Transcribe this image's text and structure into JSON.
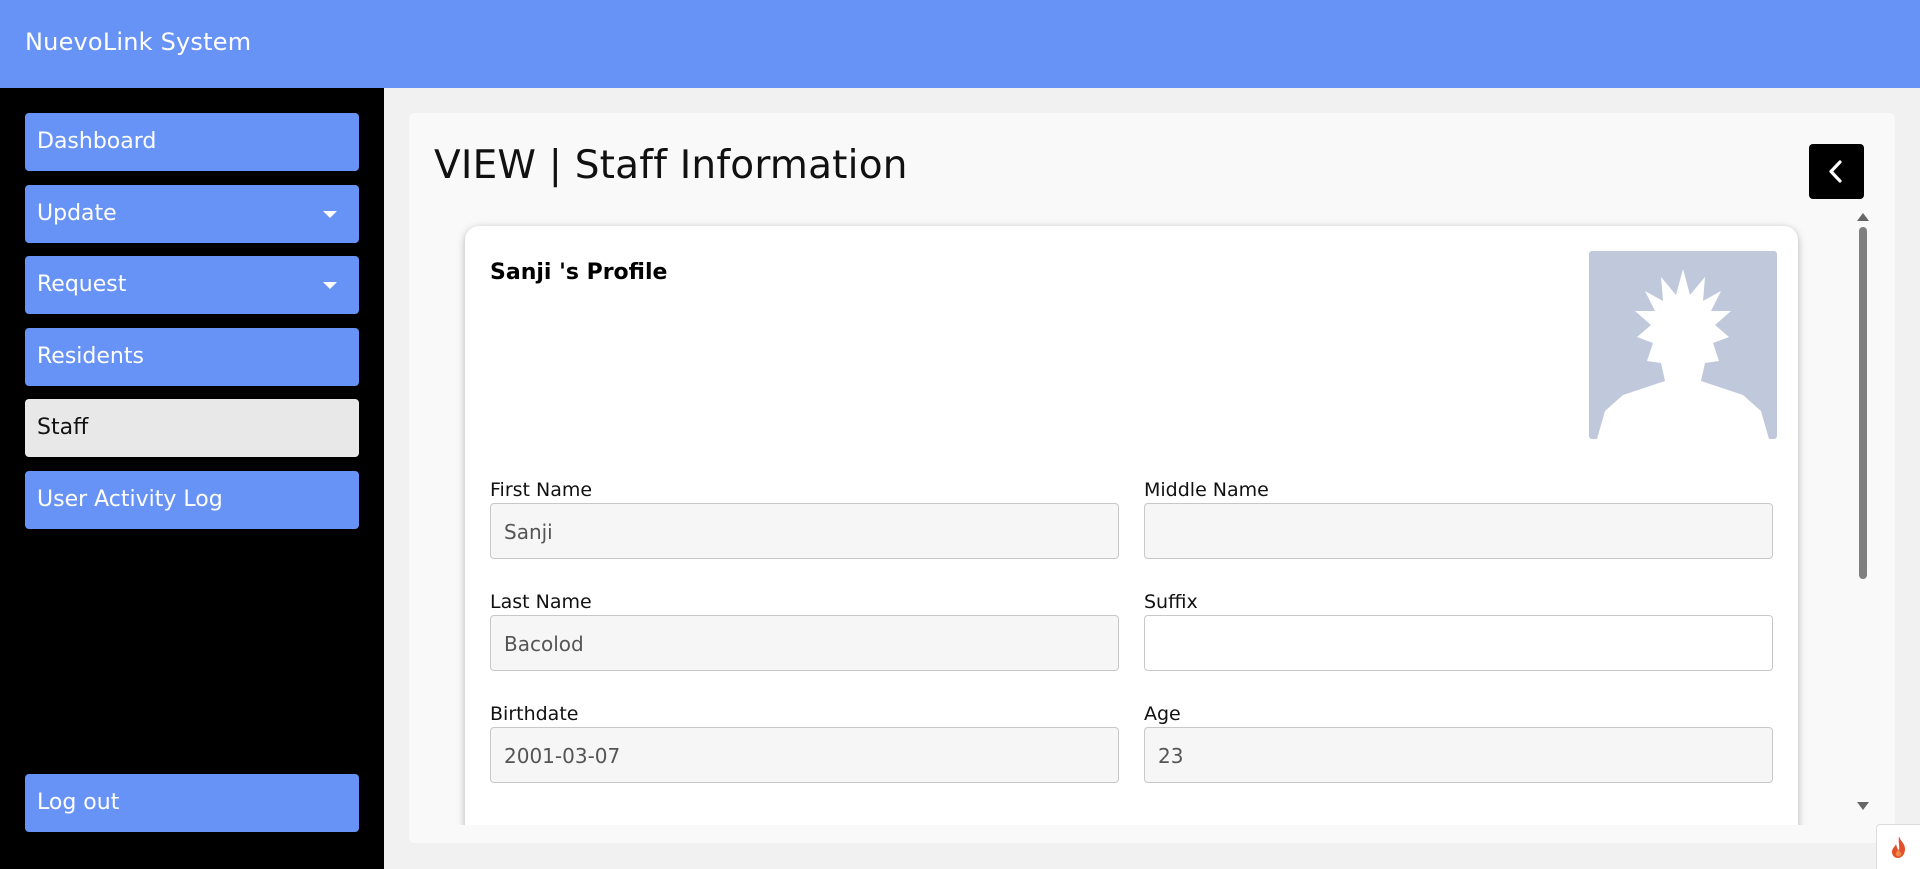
{
  "app": {
    "title": "NuevoLink System",
    "accent_color": "#6893f6"
  },
  "sidebar": {
    "items": [
      {
        "label": "Dashboard",
        "active": false,
        "has_dropdown": false
      },
      {
        "label": "Update",
        "active": false,
        "has_dropdown": true
      },
      {
        "label": "Request",
        "active": false,
        "has_dropdown": true
      },
      {
        "label": "Residents",
        "active": false,
        "has_dropdown": false
      },
      {
        "label": "Staff",
        "active": true,
        "has_dropdown": false
      },
      {
        "label": "User Activity Log",
        "active": false,
        "has_dropdown": false
      }
    ],
    "logout_label": "Log out"
  },
  "main": {
    "title": "VIEW | Staff Information",
    "back_icon": "chevron-left-icon"
  },
  "profile": {
    "title": "Sanji 's Profile",
    "avatar_icon": "user-silhouette-icon",
    "fields": {
      "first_name": {
        "label": "First Name",
        "value": "Sanji"
      },
      "middle_name": {
        "label": "Middle Name",
        "value": ""
      },
      "last_name": {
        "label": "Last Name",
        "value": "Bacolod"
      },
      "suffix": {
        "label": "Suffix",
        "value": ""
      },
      "birthdate": {
        "label": "Birthdate",
        "value": "2001-03-07"
      },
      "age": {
        "label": "Age",
        "value": "23"
      }
    }
  },
  "corner_badge_icon": "flame-icon"
}
